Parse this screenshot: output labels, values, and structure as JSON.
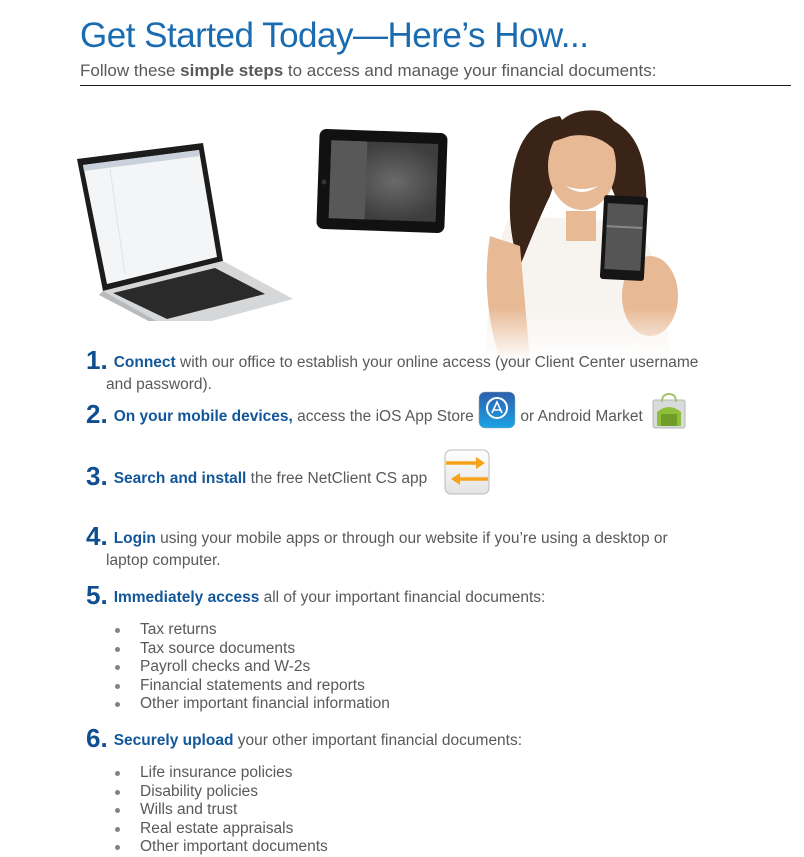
{
  "header": {
    "title": "Get Started Today—Here’s How...",
    "subtitle_pre": "Follow these ",
    "subtitle_bold": "simple steps",
    "subtitle_post": " to access and manage your financial documents:"
  },
  "hero": {
    "images": [
      "laptop",
      "tablet",
      "woman-holding-phone"
    ]
  },
  "colors": {
    "title_blue": "#1a6bb0",
    "step_number_blue": "#0f4f8f",
    "lead_blue": "#12579a",
    "body_gray": "#58595b",
    "netclient_orange": "#f7a21b"
  },
  "steps": [
    {
      "num": "1.",
      "lead": "Connect",
      "text": " with our office to establish your online access (your Client Center username",
      "cont": "and password)."
    },
    {
      "num": "2.",
      "lead": "On your mobile devices,",
      "text": " access the iOS App Store",
      "text2": " or Android Market",
      "icons": [
        "app-store-icon",
        "android-market-icon"
      ]
    },
    {
      "num": "3.",
      "lead": "Search and install",
      "text": " the free NetClient CS app",
      "icons": [
        "netclient-cs-icon"
      ]
    },
    {
      "num": "4.",
      "lead": "Login",
      "text": " using your mobile apps or through our website if you’re using a desktop or",
      "cont": "laptop computer."
    },
    {
      "num": "5.",
      "lead": "Immediately access",
      "text": " all of your important financial documents:",
      "bullets": [
        "Tax returns",
        "Tax source documents",
        "Payroll checks and W-2s",
        "Financial statements and reports",
        "Other important financial information"
      ]
    },
    {
      "num": "6.",
      "lead": "Securely upload",
      "text": " your other important financial documents:",
      "bullets": [
        "Life insurance policies",
        "Disability policies",
        "Wills and trust",
        "Real estate appraisals",
        "Other important documents"
      ]
    }
  ]
}
